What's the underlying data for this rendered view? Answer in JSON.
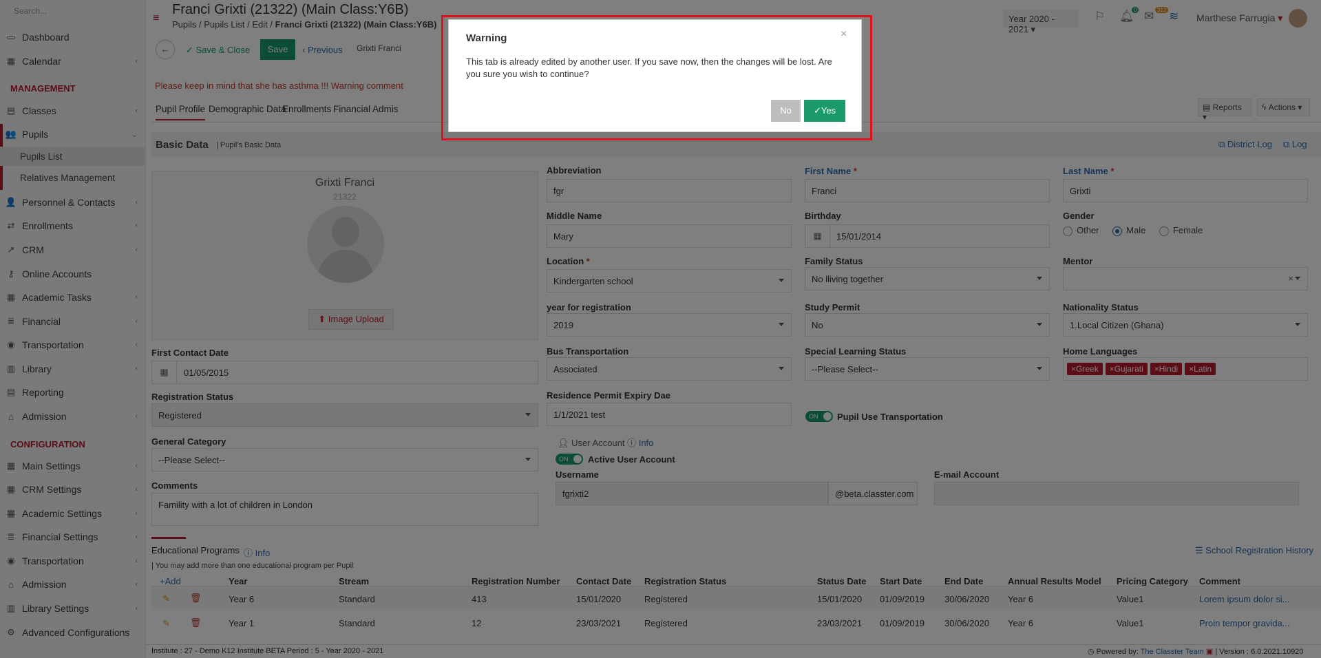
{
  "sidebar": {
    "search_placeholder": "Search...",
    "items": [
      {
        "label": "Dashboard",
        "icon": "laptop-icon"
      },
      {
        "label": "Calendar",
        "icon": "calendar-icon"
      },
      {
        "label": "Classes",
        "icon": "grid-icon"
      },
      {
        "label": "Pupils",
        "icon": "users-icon"
      },
      {
        "label": "Personnel & Contacts",
        "icon": "user-icon"
      },
      {
        "label": "Enrollments",
        "icon": "exchange-icon"
      },
      {
        "label": "CRM",
        "icon": "chart-icon"
      },
      {
        "label": "Online Accounts",
        "icon": "key-icon"
      },
      {
        "label": "Academic Tasks",
        "icon": "tasks-icon"
      },
      {
        "label": "Financial",
        "icon": "money-icon"
      },
      {
        "label": "Transportation",
        "icon": "bus-icon"
      },
      {
        "label": "Library",
        "icon": "books-icon"
      },
      {
        "label": "Reporting",
        "icon": "report-icon"
      },
      {
        "label": "Admission",
        "icon": "bank-icon"
      },
      {
        "label": "Main Settings",
        "icon": "settings-icon"
      },
      {
        "label": "CRM Settings",
        "icon": "settings-icon"
      },
      {
        "label": "Academic Settings",
        "icon": "settings-icon"
      },
      {
        "label": "Financial Settings",
        "icon": "money-icon"
      },
      {
        "label": "Transportation",
        "icon": "bus-icon"
      },
      {
        "label": "Admission",
        "icon": "bank-icon"
      },
      {
        "label": "Library Settings",
        "icon": "books-icon"
      },
      {
        "label": "Advanced Configurations",
        "icon": "gears-icon"
      }
    ],
    "section_management": "MANAGEMENT",
    "section_configuration": "CONFIGURATION",
    "sub_pupils_list": "Pupils List",
    "sub_relatives": "Relatives Management"
  },
  "header": {
    "title": "Franci Grixti (21322) (Main Class:Y6B)",
    "breadcrumb": [
      "Pupils",
      "Pupils List",
      "Edit",
      "Franci Grixti (21322) (Main Class:Y6B)"
    ],
    "year_select": "Year 2020 - 2021",
    "user_name": "Marthese Farrugia",
    "badge_bell": "0",
    "badge_mail": "312"
  },
  "toolbar": {
    "save_close": "Save & Close",
    "save": "Save",
    "previous": "Previous",
    "search_value": "Grixti Franci"
  },
  "warning_comment": "Please keep in mind that she has asthma !!! Warning comment",
  "tabs": [
    "Pupil Profile",
    "Demographic Data",
    "Enrollments",
    "Financial",
    "Admis"
  ],
  "reports_label": "Reports",
  "actions_label": "Actions",
  "basic": {
    "title": "Basic Data",
    "subtitle": "| Pupil's Basic Data",
    "district_log": "District Log",
    "log": "Log",
    "name": "Grixti Franci",
    "id": "21322",
    "image_upload": "Image Upload"
  },
  "fields": {
    "abbreviation": {
      "label": "Abbreviation",
      "value": "fgr"
    },
    "first_name": {
      "label": "First Name",
      "value": "Franci"
    },
    "last_name": {
      "label": "Last Name",
      "value": "Grixti"
    },
    "middle_name": {
      "label": "Middle Name",
      "value": "Mary"
    },
    "birthday": {
      "label": "Birthday",
      "value": "15/01/2014"
    },
    "gender": {
      "label": "Gender",
      "options": [
        "Other",
        "Male",
        "Female"
      ],
      "selected": "Male"
    },
    "location": {
      "label": "Location",
      "value": "Kindergarten school"
    },
    "family_status": {
      "label": "Family Status",
      "value": "No lliving together"
    },
    "mentor": {
      "label": "Mentor",
      "value": ""
    },
    "year_registration": {
      "label": "year for registration",
      "value": "2019"
    },
    "study_permit": {
      "label": "Study Permit",
      "value": "No"
    },
    "nationality_status": {
      "label": "Nationality Status",
      "value": "1.Local Citizen (Ghana)"
    },
    "first_contact": {
      "label": "First Contact Date",
      "value": "01/05/2015"
    },
    "bus_transport": {
      "label": "Bus Transportation",
      "value": "Associated"
    },
    "special_learning": {
      "label": "Special Learning Status",
      "value": "--Please Select--"
    },
    "home_languages": {
      "label": "Home Languages",
      "values": [
        "Greek",
        "Gujarati",
        "Hindi",
        "Latin"
      ]
    },
    "registration_status": {
      "label": "Registration Status",
      "value": "Registered"
    },
    "residence_permit": {
      "label": "Residence Permit Expiry Dae",
      "value": "1/1/2021 test"
    },
    "pupil_use_transport": {
      "label": "Pupil Use Transportation",
      "toggle": "ON"
    },
    "general_category": {
      "label": "General Category",
      "value": "--Please Select--"
    },
    "user_account": {
      "label": "User Account",
      "info": "Info"
    },
    "active_user": {
      "label": "Active User Account",
      "toggle": "ON"
    },
    "username": {
      "label": "Username",
      "value": "fgrixti2",
      "domain": "@beta.classter.com"
    },
    "email": {
      "label": "E-mail Account",
      "value": ""
    },
    "comments": {
      "label": "Comments",
      "value": "Famility with a lot of children in London"
    }
  },
  "programs": {
    "title": "Educational Programs",
    "info": "Info",
    "note": "| You may add more than one educational program per Pupil",
    "history": "School Registration History",
    "add": "Add",
    "columns": [
      "Year",
      "Stream",
      "Registration Number",
      "Contact Date",
      "Registration Status",
      "Status Date",
      "Start Date",
      "End Date",
      "Annual Results Model",
      "Pricing Category",
      "Comment"
    ],
    "rows": [
      [
        "Year 6",
        "Standard",
        "413",
        "15/01/2020",
        "Registered",
        "15/01/2020",
        "01/09/2019",
        "30/06/2020",
        "Year 6",
        "Value1",
        "Lorem ipsum dolor si..."
      ],
      [
        "Year 1",
        "Standard",
        "12",
        "23/03/2021",
        "Registered",
        "23/03/2021",
        "01/09/2019",
        "30/06/2020",
        "Year 6",
        "Value1",
        "Proin tempor gravida..."
      ]
    ]
  },
  "footer": {
    "left": "Institute : 27 - Demo K12 Institute BETA Period : 5 - Year 2020 - 2021",
    "powered": "Powered by:",
    "team": "The Classter Team",
    "version": "| Version : 6.0.2021.10920"
  },
  "modal": {
    "title": "Warning",
    "message": "This tab is already edited by another user. If you save now, then the changes will be lost. Are you sure you wish to continue?",
    "no": "No",
    "yes": "Yes"
  },
  "colors": {
    "accent": "#b81c2c",
    "primary_green": "#1b9b6a",
    "link_blue": "#2a6aa8"
  }
}
